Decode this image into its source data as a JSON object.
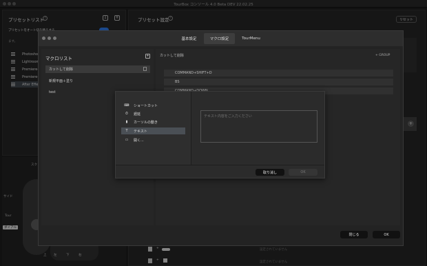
{
  "app": {
    "title": "TourBox コンソール 4.0 Beta DEV 22.02.25"
  },
  "left_panel": {
    "title": "プリセットリスト",
    "auto_label": "プリセットをオート切り替えする",
    "auto_desc": "ます。",
    "presets": [
      "Photoshop",
      "Lightroom",
      "Premiere-",
      "Premiere-",
      "After Effe"
    ]
  },
  "right_panel": {
    "title": "プリセット設定",
    "reset": "リセット",
    "bottom_texts": [
      "設定されていません",
      "設定されていません"
    ]
  },
  "device": {
    "labels": {
      "scroll": "スク",
      "side": "サイド",
      "tour": "Tour",
      "dial": "ダイアル",
      "up": "上",
      "left": "左",
      "down": "下",
      "right": "右"
    }
  },
  "settings_dialog": {
    "tabs": [
      "基本設定",
      "マクロ設定",
      "TourMenu"
    ],
    "close": "閉じる",
    "ok": "OK"
  },
  "macro": {
    "list_title": "マクロリスト",
    "items": [
      "カットして削除",
      "新規平面＋塗り",
      "test"
    ],
    "detail_title": "カットして削除",
    "group": "+ GROUP",
    "commands": [
      "COMMAND+SHIFT+D",
      "BS",
      "COMMAND+DOWN"
    ]
  },
  "add_action": {
    "menu": [
      {
        "icon": "⌨",
        "label": "ショートカット"
      },
      {
        "icon": "⏱",
        "label": "遅延"
      },
      {
        "icon": "▮",
        "label": "カーソルの動き"
      },
      {
        "icon": "T",
        "label": "テキスト"
      },
      {
        "icon": "▭",
        "label": "開く..."
      }
    ],
    "placeholder": "テキスト内容をご入力ください",
    "cancel": "取り消し",
    "ok": "OK"
  }
}
